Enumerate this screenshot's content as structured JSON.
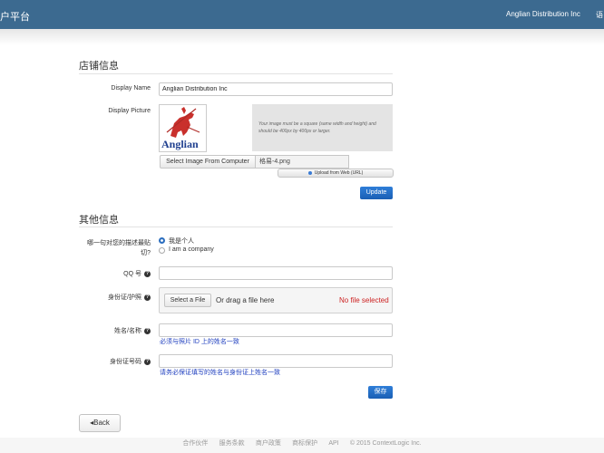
{
  "header": {
    "brand": "户平台",
    "merchant": "Anglian Distribution Inc",
    "lang": "语"
  },
  "store_info": {
    "title": "店铺信息",
    "display_name_label": "Display Name",
    "display_name_value": "Anglian Distribution Inc",
    "display_picture_label": "Display Picture",
    "logo_text": "Anglian",
    "image_note": "Your image must be a square (same width and height) and should be 400px by 400px or larger.",
    "select_image_button": "Select Image From Computer",
    "file_name": "格易-4.png",
    "upload_web_button": "Upload from Web (URL)",
    "update_button": "Update"
  },
  "other_info": {
    "title": "其他信息",
    "describe_label": "哪一句对您的描述最贴切?",
    "options": [
      "我是个人",
      "I am a company"
    ],
    "selected_option": 0,
    "qq_label": "QQ 号",
    "qq_value": "",
    "id_label": "身份证/护照",
    "select_file_button": "Select a File",
    "drag_text": "Or drag a file here",
    "no_file_text": "No file selected",
    "name_label": "姓名/名称",
    "name_value": "",
    "name_hint": "必须与照片 ID 上的姓名一致",
    "id_number_label": "身份证号码",
    "id_number_value": "",
    "id_number_hint": "请务必保证填写的姓名与身份证上姓名一致",
    "save_button": "保存"
  },
  "back_button": "◂Back",
  "footer": {
    "links": [
      "合作伙伴",
      "服务条款",
      "商户政策",
      "商标保护",
      "API",
      "© 2015 ContextLogic Inc."
    ]
  }
}
